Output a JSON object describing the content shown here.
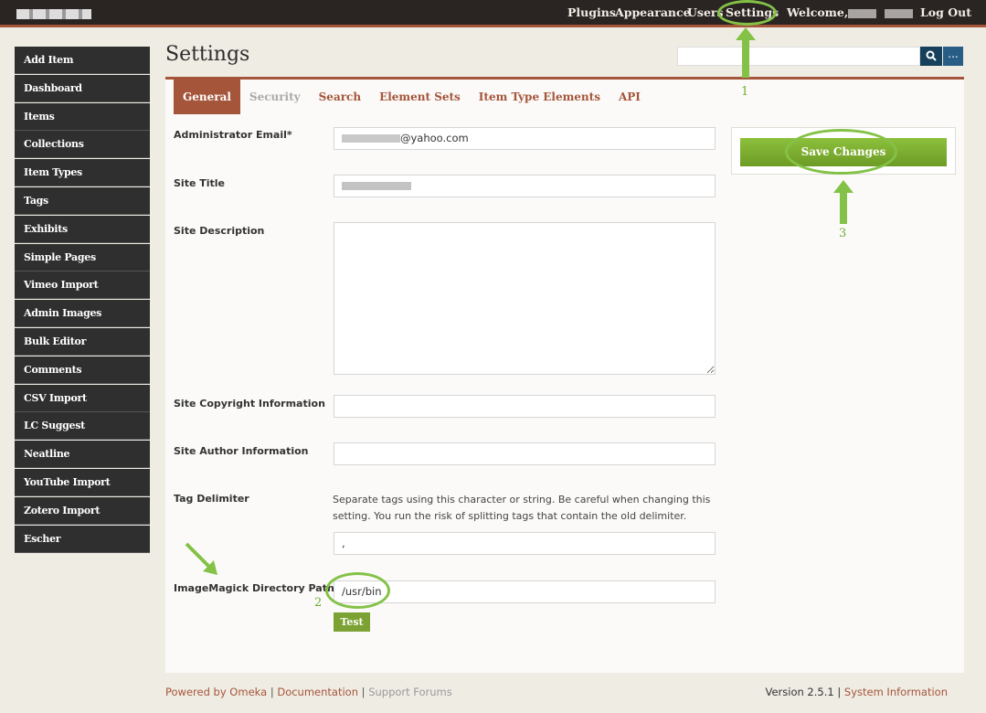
{
  "topbar": {
    "nav": [
      "Plugins",
      "Appearance",
      "Users",
      "Settings"
    ],
    "welcome": "Welcome,",
    "logout": "Log Out"
  },
  "sidebar": {
    "items": [
      "Add Item",
      "Dashboard",
      "Items",
      "Collections",
      "Item Types",
      "Tags",
      "Exhibits",
      "Simple Pages",
      "Vimeo Import",
      "Admin Images",
      "Bulk Editor",
      "Comments",
      "CSV Import",
      "LC Suggest",
      "Neatline",
      "YouTube Import",
      "Zotero Import",
      "Escher"
    ]
  },
  "page": {
    "title": "Settings"
  },
  "search": {
    "placeholder": "",
    "adv_label": "..."
  },
  "tabs": [
    {
      "label": "General",
      "state": "active"
    },
    {
      "label": "Security",
      "state": "disabled"
    },
    {
      "label": "Search",
      "state": "normal"
    },
    {
      "label": "Element Sets",
      "state": "normal"
    },
    {
      "label": "Item Type Elements",
      "state": "normal"
    },
    {
      "label": "API",
      "state": "normal"
    }
  ],
  "form": {
    "admin_email_label": "Administrator Email*",
    "admin_email_value": "@yahoo.com",
    "site_title_label": "Site Title",
    "site_description_label": "Site Description",
    "copyright_label": "Site Copyright Information",
    "author_label": "Site Author Information",
    "tag_delimiter_label": "Tag Delimiter",
    "tag_delimiter_help": "Separate tags using this character or string. Be careful when changing this setting. You run the risk of splitting tags that contain the old delimiter.",
    "tag_delimiter_value": ",",
    "imagemagick_label": "ImageMagick Directory Path",
    "imagemagick_value": "/usr/bin",
    "test_button": "Test"
  },
  "save": {
    "label": "Save Changes"
  },
  "annotations": {
    "one": "1",
    "two": "2",
    "three": "3"
  },
  "footer": {
    "powered": "Powered by Omeka",
    "documentation": "Documentation",
    "support": "Support Forums",
    "version": "Version 2.5.1",
    "sysinfo": "System Information"
  },
  "colors": {
    "accent": "#a5553a",
    "topbar": "#2a2522",
    "sidebar": "#2f2f2f",
    "save_green": "#7ba232",
    "annotation_green": "#84c247"
  }
}
